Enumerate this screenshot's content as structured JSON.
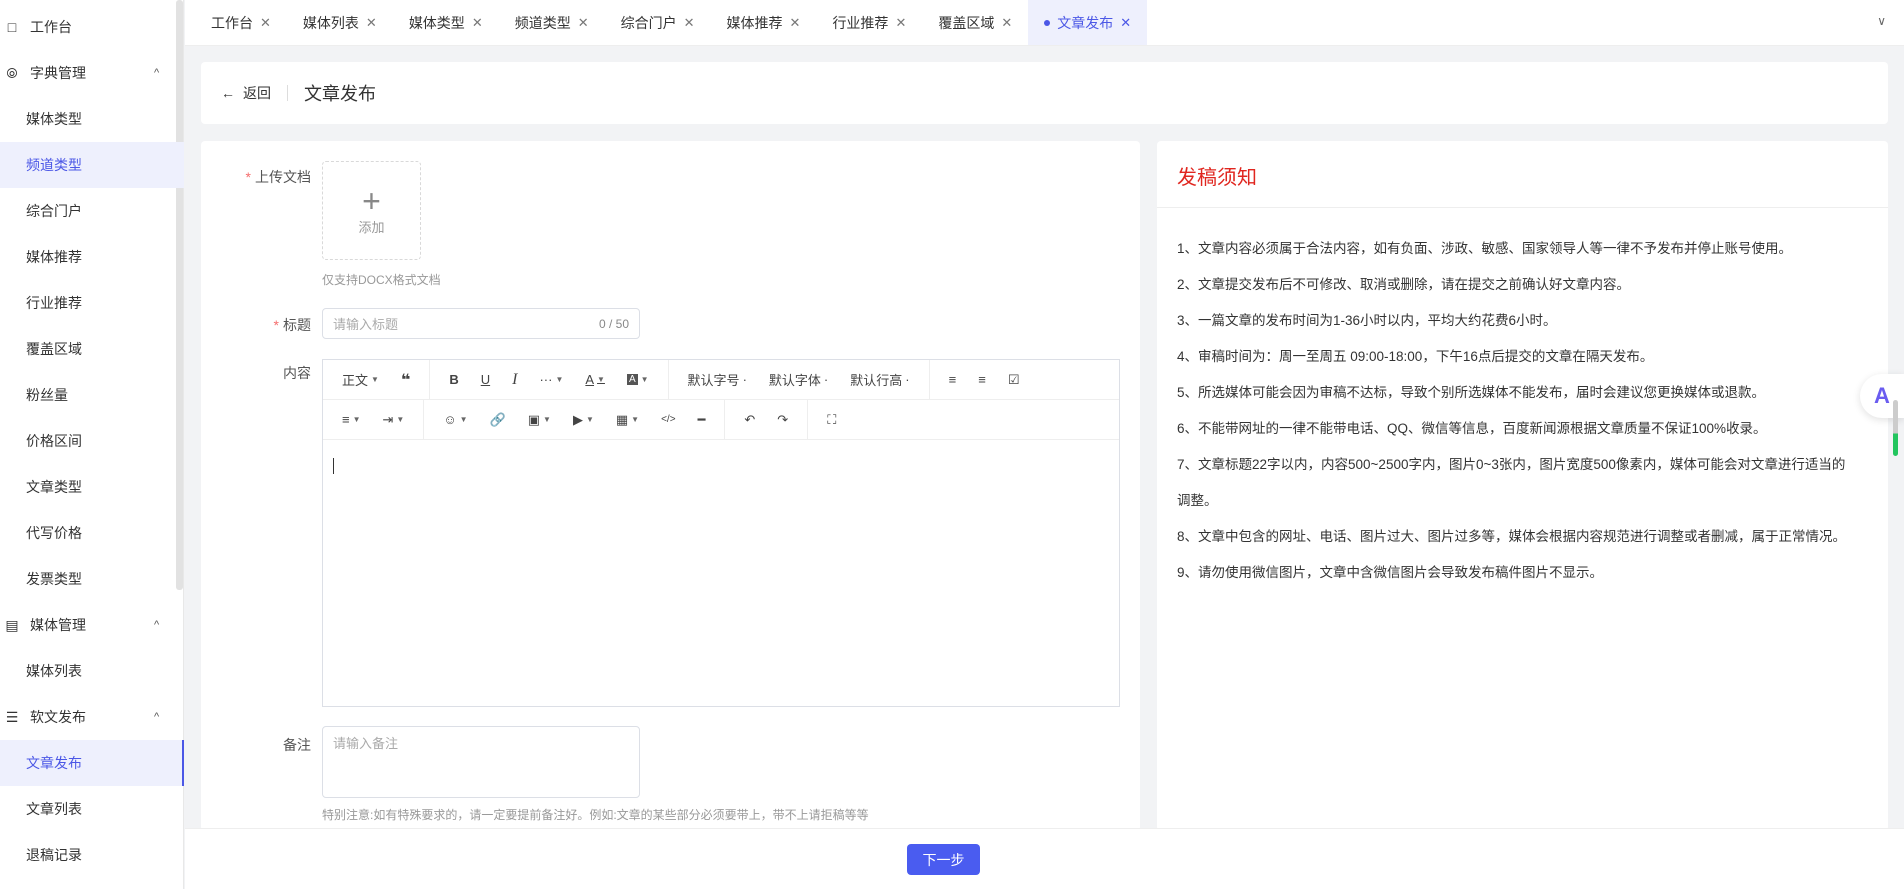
{
  "sidebar": {
    "items": [
      {
        "label": "工作台",
        "type": "top",
        "icon": "monitor-icon"
      },
      {
        "label": "字典管理",
        "type": "group",
        "icon": "dictionary-icon"
      },
      {
        "label": "媒体类型"
      },
      {
        "label": "频道类型",
        "state": "highlight"
      },
      {
        "label": "综合门户"
      },
      {
        "label": "媒体推荐"
      },
      {
        "label": "行业推荐"
      },
      {
        "label": "覆盖区域"
      },
      {
        "label": "粉丝量"
      },
      {
        "label": "价格区间"
      },
      {
        "label": "文章类型"
      },
      {
        "label": "代写价格"
      },
      {
        "label": "发票类型"
      },
      {
        "label": "媒体管理",
        "type": "group",
        "icon": "media-icon"
      },
      {
        "label": "媒体列表"
      },
      {
        "label": "软文发布",
        "type": "group",
        "icon": "list-icon"
      },
      {
        "label": "文章发布",
        "state": "active"
      },
      {
        "label": "文章列表"
      },
      {
        "label": "退稿记录"
      }
    ]
  },
  "tabs": [
    "工作台",
    "媒体列表",
    "媒体类型",
    "频道类型",
    "综合门户",
    "媒体推荐",
    "行业推荐",
    "覆盖区域",
    "文章发布"
  ],
  "header": {
    "back": "返回",
    "title": "文章发布"
  },
  "form": {
    "upload_label": "上传文档",
    "upload_add": "添加",
    "upload_hint": "仅支持DOCX格式文档",
    "title_label": "标题",
    "title_placeholder": "请输入标题",
    "title_counter": "0 / 50",
    "content_label": "内容",
    "toolbar": {
      "paragraph": "正文",
      "font_size": "默认字号",
      "font_family": "默认字体",
      "line_height": "默认行高"
    },
    "remark_label": "备注",
    "remark_placeholder": "请输入备注",
    "remark_hint": "特别注意:如有特殊要求的，请一定要提前备注好。例如:文章的某些部分必须要带上，带不上请拒稿等等"
  },
  "notice": {
    "title": "发稿须知",
    "items": [
      "1、文章内容必须属于合法内容，如有负面、涉政、敏感、国家领导人等一律不予发布并停止账号使用。",
      "2、文章提交发布后不可修改、取消或删除，请在提交之前确认好文章内容。",
      "3、一篇文章的发布时间为1-36小时以内，平均大约花费6小时。",
      "4、审稿时间为：周一至周五 09:00-18:00，下午16点后提交的文章在隔天发布。",
      "5、所选媒体可能会因为审稿不达标，导致个别所选媒体不能发布，届时会建议您更换媒体或退款。",
      "6、不能带网址的一律不能带电话、QQ、微信等信息，百度新闻源根据文章质量不保证100%收录。",
      "7、文章标题22字以内，内容500~2500字内，图片0~3张内，图片宽度500像素内，媒体可能会对文章进行适当的调整。",
      "8、文章中包含的网址、电话、图片过大、图片过多等，媒体会根据内容规范进行调整或者删减，属于正常情况。",
      "9、请勿使用微信图片，文章中含微信图片会导致发布稿件图片不显示。"
    ]
  },
  "footer": {
    "next": "下一步"
  },
  "colors": {
    "accent": "#4a5cf0",
    "notice_title": "#e0261f"
  }
}
